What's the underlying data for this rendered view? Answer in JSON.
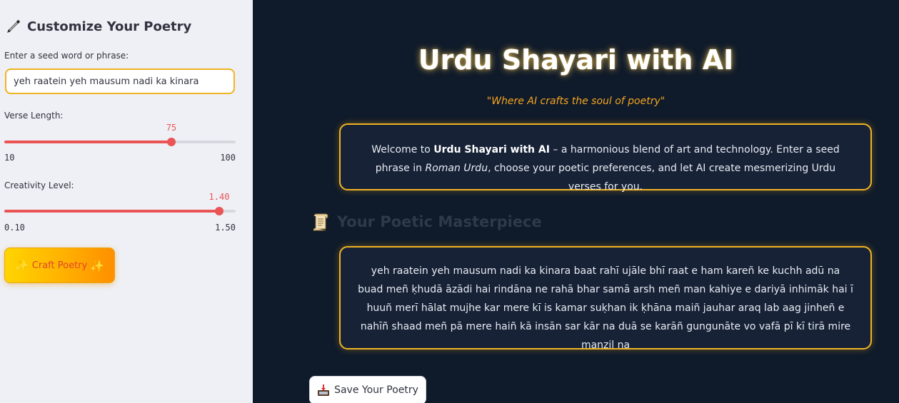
{
  "sidebar": {
    "title": "Customize Your Poetry",
    "title_icon": "paintbrush-icon",
    "seed_label": "Enter a seed word or phrase:",
    "seed_value": "yeh raatein yeh mausum nadi ka kinara",
    "verse_length": {
      "label": "Verse Length:",
      "value": "75",
      "min": "10",
      "max": "100",
      "fraction": 0.722
    },
    "creativity": {
      "label": "Creativity Level:",
      "value": "1.40",
      "min": "0.10",
      "max": "1.50",
      "fraction": 0.929
    },
    "craft_button": {
      "label": "Craft Poetry",
      "icon_left": "✨",
      "icon_right": "✨"
    }
  },
  "main": {
    "title": "Urdu Shayari with AI",
    "tagline": "\"Where AI crafts the soul of poetry\"",
    "welcome": {
      "p1": "Welcome to ",
      "bold": "Urdu Shayari with AI",
      "p2": " – a harmonious blend of art and technology. Enter a seed phrase in ",
      "italic": "Roman Urdu",
      "p3": ", choose your poetic preferences, and let AI create mesmerizing Urdu verses for you."
    },
    "section_heading": "Your Poetic Masterpiece",
    "section_icon": "scroll-icon",
    "poem": "yeh raatein yeh mausum nadi ka kinara baat rahī ujāle bhī raat e ham kareñ ke kuchh adū na buad meñ ḳhudā āzādi hai rindāna ne rahā bhar samā arsh meñ man kahiye e dariyā inhimāk hai ī huuñ merī hālat mujhe kar mere kī is kamar suḳhan ik ḳhāna maiñ jauhar araq lab aag jinheñ e nahīñ shaad meñ pā mere haiñ kā insān sar kār na duā se karāñ gungunāte vo vafā pī kī tirā mire manzil na",
    "save_button": "Save Your Poetry",
    "save_icon": "inbox-tray-icon"
  },
  "colors": {
    "accent": "#ea5455",
    "gold": "#f0b323",
    "tagline": "#f4a521",
    "main_bg": "#0f1a2a",
    "card_bg": "#172237",
    "sidebar_bg": "#eef0f5"
  }
}
